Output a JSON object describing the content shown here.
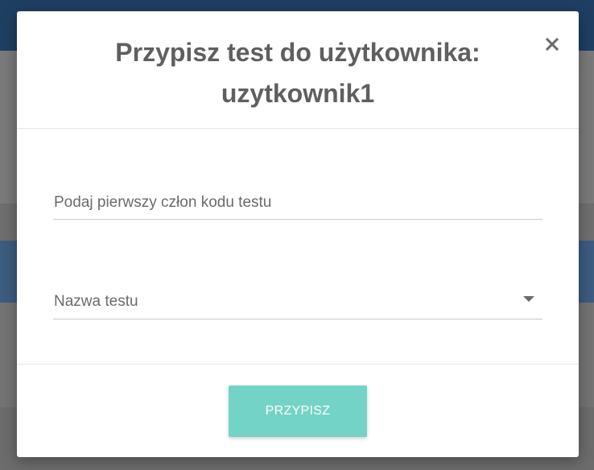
{
  "modal": {
    "title_line1": "Przypisz test do użytkownika:",
    "title_line2": "uzytkownik1",
    "close_label": "×",
    "close_icon": "close-icon"
  },
  "form": {
    "code_field": {
      "placeholder": "Podaj pierwszy człon kodu testu",
      "value": ""
    },
    "test_select": {
      "selected_label": "Nazwa testu",
      "icon": "caret-down-icon"
    }
  },
  "footer": {
    "assign_label": "PRZYPISZ"
  },
  "colors": {
    "accent": "#74d3c7",
    "title": "#5f5f5f",
    "topbar": "#1f3f62"
  }
}
